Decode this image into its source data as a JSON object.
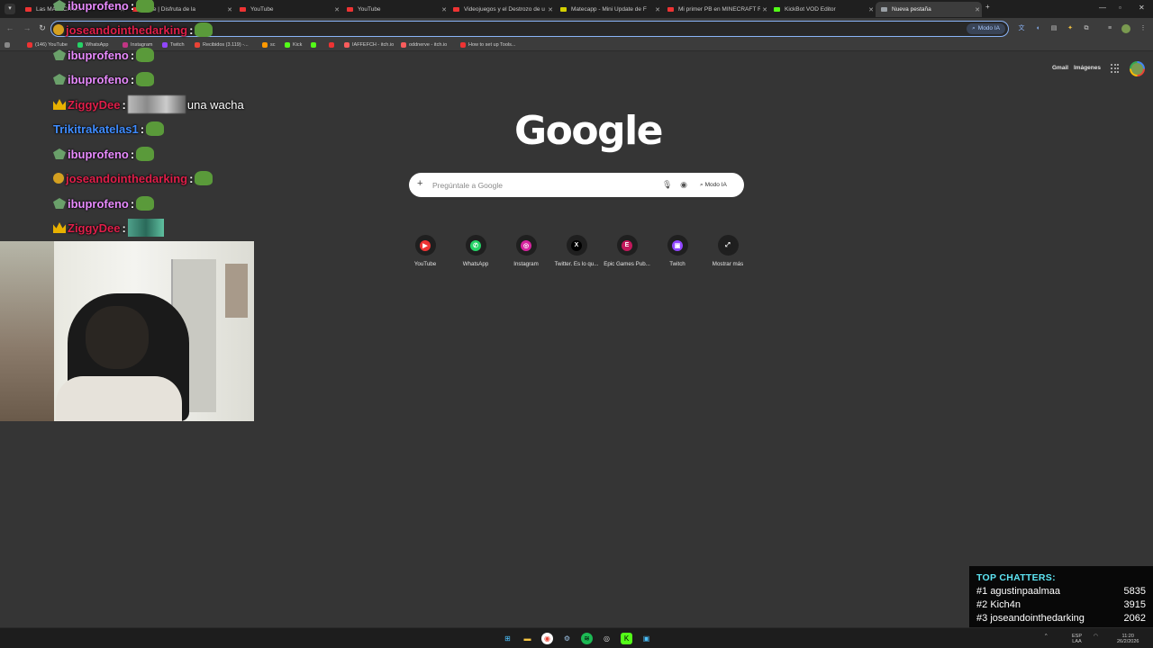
{
  "tabs": [
    {
      "title": "Las MATECITO...",
      "fav": "#e33"
    },
    {
      "title": "mate | Disfruta de la",
      "fav": "#e33"
    },
    {
      "title": "YouTube",
      "fav": "#e33"
    },
    {
      "title": "YouTube",
      "fav": "#e33"
    },
    {
      "title": "Videojuegos y el Destrozo de u",
      "fav": "#e33"
    },
    {
      "title": "Matecapp - Mini Update de F",
      "fav": "#d4d000"
    },
    {
      "title": "Mi primer PB en MINECRAFT R",
      "fav": "#e33"
    },
    {
      "title": "KickBot VOD Editor",
      "fav": "#53fc18"
    },
    {
      "title": "Nueva pestaña",
      "fav": "#9aa0a6"
    }
  ],
  "new_tab_symbol": "+",
  "omnibox": {
    "modo_ia": "Modo IA"
  },
  "bookmarks": [
    {
      "label": "(146) YouTube",
      "color": "#e33"
    },
    {
      "label": "WhatsApp",
      "color": "#25d366"
    },
    {
      "label": "Instagram",
      "color": "#c13584"
    },
    {
      "label": "Twitch",
      "color": "#9146ff"
    },
    {
      "label": "Recibidos (3.119) -...",
      "color": "#ea4335"
    },
    {
      "label": "sc",
      "color": "#f90"
    },
    {
      "label": "Kick",
      "color": "#53fc18"
    },
    {
      "label": "",
      "color": "#53fc18"
    },
    {
      "label": "",
      "color": "#e33"
    },
    {
      "label": "IAFFEFCH - itch.io",
      "color": "#fa5c5c"
    },
    {
      "label": "oddnerve - itch.io",
      "color": "#fa5c5c"
    },
    {
      "label": "How to set up Tools...",
      "color": "#e33"
    }
  ],
  "google": {
    "gmail": "Gmail",
    "imagenes": "Imágenes",
    "logo": "Google",
    "search_placeholder": "Pregúntale a Google",
    "modo_ia": "Modo IA",
    "shortcuts": [
      {
        "label": "YouTube",
        "icon": "youtube-icon",
        "color": "#e33",
        "glyph": "▶"
      },
      {
        "label": "WhatsApp",
        "icon": "whatsapp-icon",
        "color": "#25d366",
        "glyph": "✆"
      },
      {
        "label": "Instagram",
        "icon": "instagram-icon",
        "color": "#d6249f",
        "glyph": "◎"
      },
      {
        "label": "Twitter. Es lo qu...",
        "icon": "x-icon",
        "color": "#000",
        "glyph": "X"
      },
      {
        "label": "Epic Games Pub...",
        "icon": "epic-icon",
        "color": "#c2185b",
        "glyph": "E"
      },
      {
        "label": "Twitch",
        "icon": "twitch-icon",
        "color": "#9146ff",
        "glyph": "▣"
      },
      {
        "label": "Mostrar más",
        "icon": "expand-icon",
        "color": "#1f1f1f",
        "glyph": "⤢"
      }
    ]
  },
  "chat": [
    {
      "user": "ibuprofeno",
      "color": "#e98bff",
      "badge": "mod",
      "msg": ""
    },
    {
      "user": "joseandointhedarking",
      "color": "#e01f4a",
      "badge": "coin",
      "msg": ""
    },
    {
      "user": "ibuprofeno",
      "color": "#e98bff",
      "badge": "mod",
      "msg": ""
    },
    {
      "user": "ibuprofeno",
      "color": "#e98bff",
      "badge": "mod",
      "msg": ""
    },
    {
      "user": "ZiggyDee",
      "color": "#e01f4a",
      "badge": "crown",
      "msg": "una wacha"
    },
    {
      "user": "Trikitrakatelas1",
      "color": "#3f8cff",
      "badge": "",
      "msg": ""
    },
    {
      "user": "ibuprofeno",
      "color": "#e98bff",
      "badge": "mod",
      "msg": ""
    },
    {
      "user": "joseandointhedarking",
      "color": "#e01f4a",
      "badge": "coin",
      "msg": ""
    },
    {
      "user": "ibuprofeno",
      "color": "#e98bff",
      "badge": "mod",
      "msg": ""
    },
    {
      "user": "ZiggyDee",
      "color": "#e01f4a",
      "badge": "crown",
      "msg": ""
    }
  ],
  "top_chatters": {
    "title": "TOP CHATTERS:",
    "rows": [
      {
        "rank": "#1",
        "name": "agustinpaalmaa",
        "count": "5835"
      },
      {
        "rank": "#2",
        "name": "Kich4n",
        "count": "3915"
      },
      {
        "rank": "#3",
        "name": "joseandointhedarking",
        "count": "2062"
      }
    ]
  },
  "tray": {
    "lang": "ESP",
    "lang2": "LAA",
    "date": "26/2/2026",
    "time": "11:20"
  }
}
